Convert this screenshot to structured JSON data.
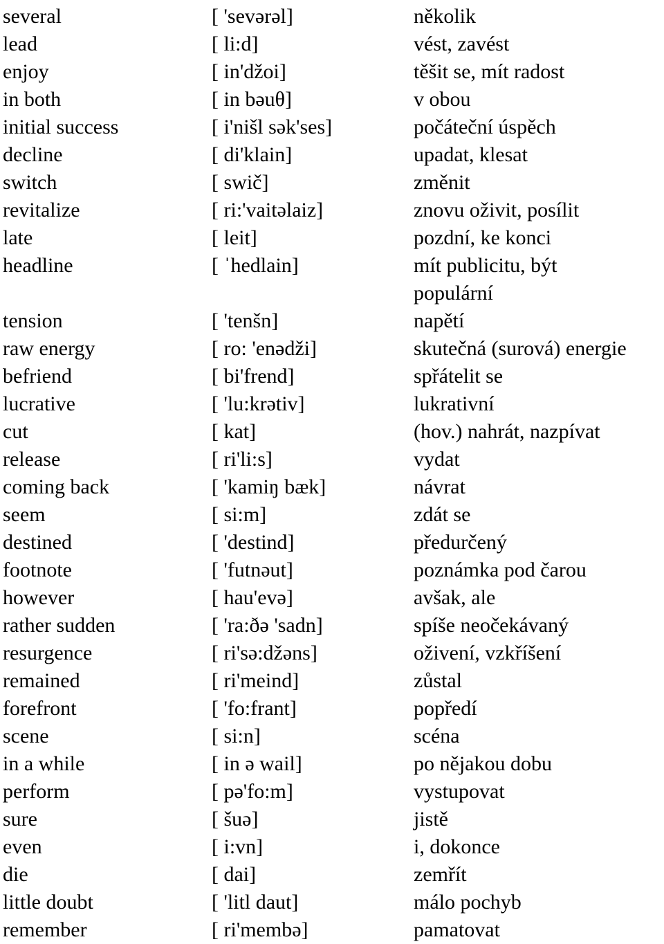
{
  "document": {
    "type": "vocabulary-glossary",
    "columns": [
      "term",
      "pronunciation",
      "meaning"
    ],
    "language_pair": "English - Czech"
  },
  "entries": [
    {
      "term": "several",
      "pron": "[ 'sevərəl]",
      "meaning": "několik"
    },
    {
      "term": "lead",
      "pron": "[ li:d]",
      "meaning": "vést, zavést"
    },
    {
      "term": "enjoy",
      "pron": "[ in'džoi]",
      "meaning": "těšit se, mít radost"
    },
    {
      "term": "in both",
      "pron": "[ in bəuθ]",
      "meaning": "v obou"
    },
    {
      "term": "initial success",
      "pron": "[ i'nišl sək'ses]",
      "meaning": "počáteční úspěch"
    },
    {
      "term": "decline",
      "pron": "[ di'klain]",
      "meaning": "upadat, klesat"
    },
    {
      "term": "switch",
      "pron": "[ swič]",
      "meaning": "změnit"
    },
    {
      "term": "revitalize",
      "pron": "[ ri:'vaitəlaiz]",
      "meaning": "znovu oživit, posílit"
    },
    {
      "term": "late",
      "pron": "[ leit]",
      "meaning": "pozdní, ke konci"
    },
    {
      "term": "headline",
      "pron": "[ ˈhedlain]",
      "meaning": "mít publicitu, být",
      "meaning_line2": "populární"
    },
    {
      "term": "tension",
      "pron": "[ 'tenšn]",
      "meaning": "napětí"
    },
    {
      "term": "raw energy",
      "pron": "[ ro: 'enədži]",
      "meaning": "skutečná (surová) energie"
    },
    {
      "term": "befriend",
      "pron": "[ bi'frend]",
      "meaning": "spřátelit se"
    },
    {
      "term": "lucrative",
      "pron": "[ 'lu:krətiv]",
      "meaning": "lukrativní"
    },
    {
      "term": "cut",
      "pron": "[ kat]",
      "meaning": "(hov.) nahrát, nazpívat"
    },
    {
      "term": "release",
      "pron": "[ ri'li:s]",
      "meaning": "vydat"
    },
    {
      "term": "coming back",
      "pron": "[ 'kamiŋ bæk]",
      "meaning": "návrat"
    },
    {
      "term": "seem",
      "pron": "[ si:m]",
      "meaning": "zdát se"
    },
    {
      "term": "destined",
      "pron": "[ 'destind]",
      "meaning": "předurčený"
    },
    {
      "term": "footnote",
      "pron": "[ 'futnəut]",
      "meaning": "poznámka pod čarou"
    },
    {
      "term": "however",
      "pron": "[ hau'evə]",
      "meaning": "avšak, ale"
    },
    {
      "term": "rather sudden",
      "pron": "[ 'ra:ðə 'sadn]",
      "meaning": "spíše neočekávaný"
    },
    {
      "term": "resurgence",
      "pron": "[ ri'sə:džəns]",
      "meaning": "oživení, vzkříšení"
    },
    {
      "term": "remained",
      "pron": "[ ri'meind]",
      "meaning": "zůstal"
    },
    {
      "term": "forefront",
      "pron": "[ 'fo:frant]",
      "meaning": "popředí"
    },
    {
      "term": "scene",
      "pron": "[ si:n]",
      "meaning": "scéna"
    },
    {
      "term": "in a while",
      "pron": "[ in ə wail]",
      "meaning": "po nějakou dobu"
    },
    {
      "term": "perform",
      "pron": "[ pə'fo:m]",
      "meaning": "vystupovat"
    },
    {
      "term": "sure",
      "pron": "[ šuə]",
      "meaning": "jistě"
    },
    {
      "term": "even",
      "pron": "[ i:vn]",
      "meaning": "i, dokonce"
    },
    {
      "term": "die",
      "pron": "[ dai]",
      "meaning": "zemřít"
    },
    {
      "term": "little doubt",
      "pron": "[ 'litl daut]",
      "meaning": "málo pochyb"
    },
    {
      "term": "remember",
      "pron": "[ ri'membə]",
      "meaning": "pamatovat"
    }
  ]
}
